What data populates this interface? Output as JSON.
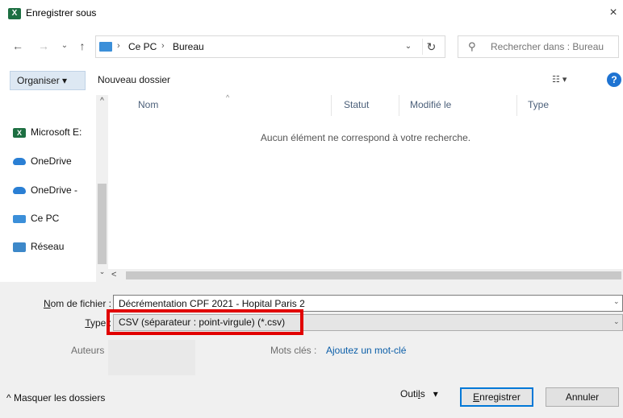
{
  "window": {
    "title": "Enregistrer sous",
    "app_icon": "excel-icon",
    "close_label": "×"
  },
  "nav": {
    "back": "←",
    "forward": "→",
    "recent": "⌄",
    "up": "↑"
  },
  "address": {
    "separator": "›",
    "crumbs": [
      "Ce PC",
      "Bureau"
    ],
    "dropdown": "⌄",
    "refresh": "↻"
  },
  "search": {
    "icon": "⚲",
    "placeholder": "Rechercher dans : Bureau"
  },
  "toolbar": {
    "organize_label": "Organiser ▾",
    "new_folder_label": "Nouveau dossier",
    "view_label": "☷ ▾",
    "help_label": "?"
  },
  "sidebar": {
    "scroll_up": "^",
    "scroll_down": "⌄",
    "items": [
      {
        "label": "Microsoft E:",
        "icon": "excel-icon"
      },
      {
        "label": "OneDrive",
        "icon": "onedrive-icon"
      },
      {
        "label": "OneDrive -",
        "icon": "onedrive-icon"
      },
      {
        "label": "Ce PC",
        "icon": "computer-icon"
      },
      {
        "label": "Réseau",
        "icon": "network-icon"
      }
    ]
  },
  "file_list": {
    "columns": [
      "Nom",
      "Statut",
      "Modifié le",
      "Type"
    ],
    "sort_indicator": "^",
    "empty_message": "Aucun élément ne correspond à votre recherche.",
    "hscroll_left": "<"
  },
  "form": {
    "filename_label_pre": "",
    "filename_label_u": "N",
    "filename_label_post": "om de fichier :",
    "filename_value": "Décrémentation CPF 2021 - Hopital Paris 2",
    "type_label_u": "T",
    "type_label_post": "ype :",
    "type_value": "CSV (séparateur : point-virgule) (*.csv)",
    "dropdown": "⌄",
    "authors_label": "Auteurs",
    "tags_label": "Mots clés :",
    "tags_link": "Ajoutez un mot-clé"
  },
  "footer": {
    "hide_folders_label": "Masquer les dossiers",
    "tools_label_pre": "Outi",
    "tools_label_u": "l",
    "tools_label_post": "s",
    "tools_caret": "▾",
    "save_label_u": "E",
    "save_label_post": "nregistrer",
    "cancel_label": "Annuler"
  },
  "colors": {
    "accent": "#0078d7",
    "highlight": "#e10000",
    "excel": "#1d6f42"
  }
}
